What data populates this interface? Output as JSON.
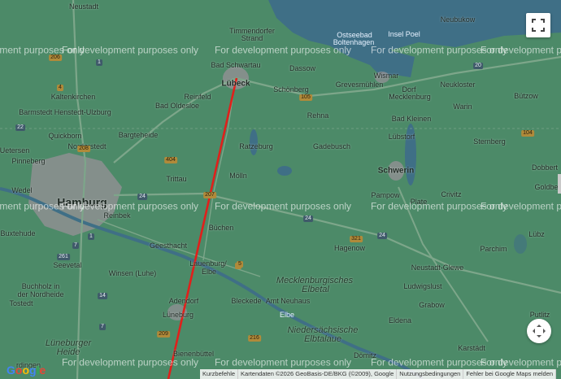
{
  "watermark": "For development purposes only",
  "colors": {
    "land": "#4c8a68",
    "water": "#3f6f86",
    "urban": "#8e8f92",
    "route": "#e0201b",
    "road": "#6f9a7c"
  },
  "places": [
    {
      "text": "Neustadt",
      "cls": "place"
    },
    {
      "text": "Timmendorfer",
      "cls": "place"
    },
    {
      "text": "Strand",
      "cls": "place"
    },
    {
      "text": "Ostseebad",
      "cls": "place water"
    },
    {
      "text": "Boltenhagen",
      "cls": "place water"
    },
    {
      "text": "Insel Poel",
      "cls": "place water"
    },
    {
      "text": "Neubukow",
      "cls": "place"
    },
    {
      "text": "Bad Schwartau",
      "cls": "place"
    },
    {
      "text": "Dassow",
      "cls": "place"
    },
    {
      "text": "Wismar",
      "cls": "place"
    },
    {
      "text": "Lübeck",
      "cls": "place town"
    },
    {
      "text": "Dorf",
      "cls": "place"
    },
    {
      "text": "Mecklenburg",
      "cls": "place"
    },
    {
      "text": "Neukloster",
      "cls": "place"
    },
    {
      "text": "Kaltenkirchen",
      "cls": "place"
    },
    {
      "text": "Reinfeld",
      "cls": "place"
    },
    {
      "text": "Schönberg",
      "cls": "place"
    },
    {
      "text": "Grevesmühlen",
      "cls": "place"
    },
    {
      "text": "Bützow",
      "cls": "place"
    },
    {
      "text": "Barmstedt Henstedt-Ulzburg",
      "cls": "place"
    },
    {
      "text": "Bad Oldesloe",
      "cls": "place"
    },
    {
      "text": "Warin",
      "cls": "place"
    },
    {
      "text": "Rehna",
      "cls": "place"
    },
    {
      "text": "Bad Kleinen",
      "cls": "place"
    },
    {
      "text": "Quickborn",
      "cls": "place"
    },
    {
      "text": "Bargteheide",
      "cls": "place"
    },
    {
      "text": "Norderstedt",
      "cls": "place"
    },
    {
      "text": "Lübstorf",
      "cls": "place"
    },
    {
      "text": "Uetersen",
      "cls": "place"
    },
    {
      "text": "Ratzeburg",
      "cls": "place"
    },
    {
      "text": "Gadebusch",
      "cls": "place"
    },
    {
      "text": "Sternberg",
      "cls": "place"
    },
    {
      "text": "Pinneberg",
      "cls": "place"
    },
    {
      "text": "Dobbert",
      "cls": "place"
    },
    {
      "text": "Schwerin",
      "cls": "place town"
    },
    {
      "text": "Trittau",
      "cls": "place"
    },
    {
      "text": "Mölln",
      "cls": "place"
    },
    {
      "text": "Goldbe",
      "cls": "place"
    },
    {
      "text": "Wedel",
      "cls": "place"
    },
    {
      "text": "Hamburg",
      "cls": "place city"
    },
    {
      "text": "Pampow",
      "cls": "place"
    },
    {
      "text": "Crivitz",
      "cls": "place"
    },
    {
      "text": "Plate",
      "cls": "place"
    },
    {
      "text": "Reinbek",
      "cls": "place"
    },
    {
      "text": "Büchen",
      "cls": "place"
    },
    {
      "text": "Buxtehude",
      "cls": "place"
    },
    {
      "text": "Hagenow",
      "cls": "place"
    },
    {
      "text": "Lübz",
      "cls": "place"
    },
    {
      "text": "Geesthacht",
      "cls": "place"
    },
    {
      "text": "Parchim",
      "cls": "place"
    },
    {
      "text": "Seevetal",
      "cls": "place"
    },
    {
      "text": "Lauenburg/",
      "cls": "place"
    },
    {
      "text": "Elbe",
      "cls": "place"
    },
    {
      "text": "Neustadt-Glewe",
      "cls": "place"
    },
    {
      "text": "Winsen (Luhe)",
      "cls": "place"
    },
    {
      "text": "Mecklenburgisches",
      "cls": "place region"
    },
    {
      "text": "Elbetal",
      "cls": "place region"
    },
    {
      "text": "Ludwigslust",
      "cls": "place"
    },
    {
      "text": "Buchholz in",
      "cls": "place"
    },
    {
      "text": "der Nordheide",
      "cls": "place"
    },
    {
      "text": "Tostedt",
      "cls": "place"
    },
    {
      "text": "Adendorf",
      "cls": "place"
    },
    {
      "text": "Bleckede",
      "cls": "place"
    },
    {
      "text": "Amt Neuhaus",
      "cls": "place"
    },
    {
      "text": "Grabow",
      "cls": "place"
    },
    {
      "text": "Lüneburg",
      "cls": "place"
    },
    {
      "text": "Elbe",
      "cls": "place water"
    },
    {
      "text": "Eldena",
      "cls": "place"
    },
    {
      "text": "Putlitz",
      "cls": "place"
    },
    {
      "text": "Niedersächsische",
      "cls": "place region"
    },
    {
      "text": "Elbtalaue",
      "cls": "place region"
    },
    {
      "text": "Lüneburger",
      "cls": "place region"
    },
    {
      "text": "Heide",
      "cls": "place region"
    },
    {
      "text": "Karstädt",
      "cls": "place"
    },
    {
      "text": "Bienenbüttel",
      "cls": "place"
    },
    {
      "text": "Dömitz",
      "cls": "place"
    },
    {
      "text": "rdingen",
      "cls": "place"
    }
  ],
  "shields": [
    "206",
    "1",
    "4",
    "20",
    "105",
    "22",
    "208",
    "104",
    "404",
    "24",
    "207",
    "24",
    "321",
    "24",
    "5",
    "1",
    "7",
    "261",
    "14",
    "7",
    "209",
    "216",
    "5"
  ],
  "controls": {
    "fullscreen_icon": "fullscreen-icon",
    "pan_icon": "pan-arrows-icon"
  },
  "logo": {
    "text": "Google"
  },
  "attribution": {
    "shortcuts": "Kurzbefehle",
    "map_data": "Kartendaten ©2026 GeoBasis-DE/BKG (©2009), Google",
    "terms": "Nutzungsbedingungen",
    "report": "Fehler bei Google Maps melden"
  }
}
